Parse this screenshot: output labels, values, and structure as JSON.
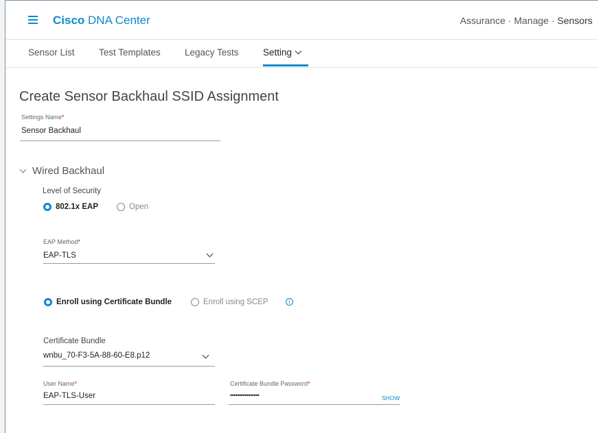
{
  "header": {
    "brand_bold": "Cisco",
    "brand_rest": "DNA Center",
    "breadcrumb": [
      "Assurance",
      "Manage",
      "Sensors"
    ],
    "separator": "·"
  },
  "tabs": [
    {
      "label": "Sensor List",
      "active": false
    },
    {
      "label": "Test Templates",
      "active": false
    },
    {
      "label": "Legacy Tests",
      "active": false
    },
    {
      "label": "Setting",
      "active": true
    }
  ],
  "form": {
    "title": "Create Sensor Backhaul SSID Assignment",
    "settings_name_label": "Settings Name",
    "settings_name_value": "Sensor Backhaul",
    "required_mark": "*"
  },
  "wired_backhaul": {
    "heading": "Wired Backhaul",
    "security_label": "Level of Security",
    "security_options": [
      {
        "label": "802.1x EAP",
        "selected": true
      },
      {
        "label": "Open",
        "selected": false
      }
    ],
    "eap_method_label": "EAP Method",
    "eap_method_value": "EAP-TLS",
    "enroll_options": [
      {
        "label": "Enroll using Certificate Bundle",
        "selected": true
      },
      {
        "label": "Enroll using SCEP",
        "selected": false
      }
    ],
    "cert_bundle_label": "Certificate Bundle",
    "cert_bundle_value": "wnbu_70-F3-5A-88-60-E8.p12",
    "user_name_label": "User Name",
    "user_name_value": "EAP-TLS-User",
    "password_label": "Certificate Bundle Password",
    "password_value": "••••••••••••••••",
    "show_label": "SHOW"
  },
  "icons": {
    "menu": "hamburger-icon",
    "info": "info-icon",
    "info_glyph": "i"
  },
  "colors": {
    "accent": "#0b8acb",
    "required": "#d0021b"
  }
}
